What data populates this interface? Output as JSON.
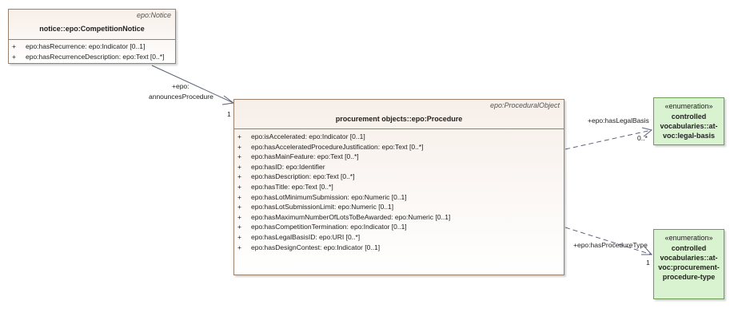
{
  "notice_class": {
    "stereotype": "epo:Notice",
    "title": "notice::epo:CompetitionNotice",
    "attributes": [
      {
        "visibility": "+",
        "text": "epo:hasRecurrence: epo:Indicator [0..1]"
      },
      {
        "visibility": "+",
        "text": "epo:hasRecurrenceDescription: epo:Text [0..*]"
      }
    ]
  },
  "procedure_class": {
    "stereotype": "epo:ProceduralObject",
    "title": "procurement objects::epo:Procedure",
    "attributes": [
      {
        "visibility": "+",
        "text": "epo:isAccelerated: epo:Indicator [0..1]"
      },
      {
        "visibility": "+",
        "text": "epo:hasAcceleratedProcedureJustification: epo:Text [0..*]"
      },
      {
        "visibility": "+",
        "text": "epo:hasMainFeature: epo:Text [0..*]"
      },
      {
        "visibility": "+",
        "text": "epo:hasID: epo:Identifier"
      },
      {
        "visibility": "+",
        "text": "epo:hasDescription: epo:Text [0..*]"
      },
      {
        "visibility": "+",
        "text": "epo:hasTitle: epo:Text [0..*]"
      },
      {
        "visibility": "+",
        "text": "epo:hasLotMinimumSubmission: epo:Numeric [0..1]"
      },
      {
        "visibility": "+",
        "text": "epo:hasLotSubmissionLimit: epo:Numeric [0..1]"
      },
      {
        "visibility": "+",
        "text": "epo:hasMaximumNumberOfLotsToBeAwarded: epo:Numeric [0..1]"
      },
      {
        "visibility": "+",
        "text": "epo:hasCompetitionTermination: epo:Indicator [0..1]"
      },
      {
        "visibility": "+",
        "text": "epo:hasLegalBasisID: epo:URI [0..*]"
      },
      {
        "visibility": "+",
        "text": "epo:hasDesignContest: epo:Indicator [0..1]"
      }
    ]
  },
  "legal_basis_enum": {
    "stereotype": "«enumeration»",
    "name_lines": [
      "controlled",
      "vocabularies::at-",
      "voc:legal-basis"
    ]
  },
  "procedure_type_enum": {
    "stereotype": "«enumeration»",
    "name_lines": [
      "controlled",
      "vocabularies::at-",
      "voc:procurement-",
      "procedure-type"
    ]
  },
  "links": {
    "announces": {
      "role_line1": "+epo:",
      "role_line2": "announcesProcedure",
      "multiplicity": "1"
    },
    "legal_basis": {
      "role": "+epo:hasLegalBasis",
      "multiplicity": "0..*"
    },
    "procedure_type": {
      "role": "+epo:hasProcedureType",
      "multiplicity": "1"
    }
  },
  "colors": {
    "class_border": "#9a7f6a",
    "class_fill_top": "#f7efe9",
    "enum_fill": "#d9f2cf",
    "enum_border": "#6f9c5a",
    "link_line": "#5a6378"
  }
}
